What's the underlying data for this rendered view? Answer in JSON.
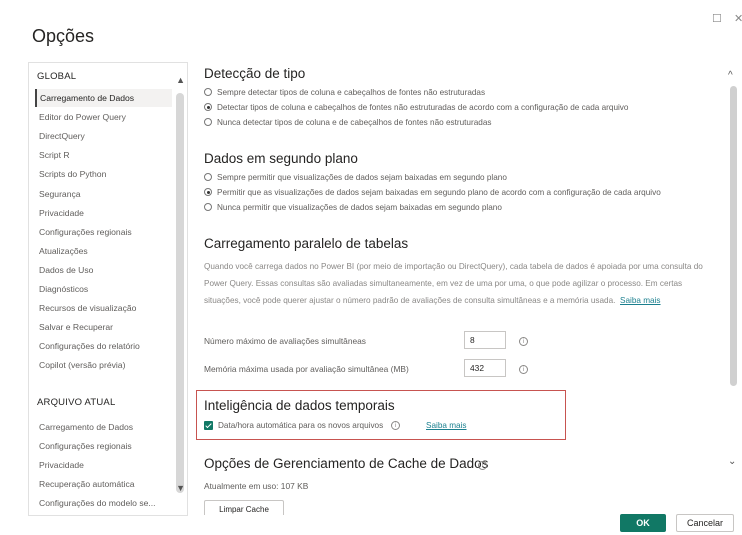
{
  "window": {
    "title": "Opções",
    "maximize_glyph": "☐",
    "close_glyph": "✕"
  },
  "nav": {
    "global_heading": "GLOBAL",
    "global_items": [
      "Carregamento de Dados",
      "Editor do Power Query",
      "DirectQuery",
      "Script R",
      "Scripts do Python",
      "Segurança",
      "Privacidade",
      "Configurações regionais",
      "Atualizações",
      "Dados de Uso",
      "Diagnósticos",
      "Recursos de visualização",
      "Salvar e Recuperar",
      "Configurações do relatório",
      "Copilot (versão prévia)"
    ],
    "current_heading": "ARQUIVO ATUAL",
    "current_items": [
      "Carregamento de Dados",
      "Configurações regionais",
      "Privacidade",
      "Recuperação automática",
      "Configurações do modelo se..."
    ],
    "active_item": "Carregamento de Dados"
  },
  "type_detection": {
    "title": "Detecção de tipo",
    "options": [
      {
        "label": "Sempre detectar tipos de coluna e cabeçalhos de fontes não estruturadas",
        "selected": false
      },
      {
        "label": "Detectar tipos de coluna e cabeçalhos de fontes não estruturadas de acordo com a configuração de cada arquivo",
        "selected": true
      },
      {
        "label": "Nunca detectar tipos de coluna e de cabeçalhos de fontes não estruturadas",
        "selected": false
      }
    ]
  },
  "background_data": {
    "title": "Dados em segundo plano",
    "options": [
      {
        "label": "Sempre permitir que visualizações de dados sejam baixadas em segundo plano",
        "selected": false
      },
      {
        "label": "Permitir que as visualizações de dados sejam baixadas em segundo plano de acordo com a configuração de cada arquivo",
        "selected": true
      },
      {
        "label": "Nunca permitir que visualizações de dados sejam baixadas em segundo plano",
        "selected": false
      }
    ]
  },
  "parallel_loading": {
    "title": "Carregamento paralelo de tabelas",
    "description": "Quando você carrega dados no Power BI (por meio de importação ou DirectQuery), cada tabela de dados é apoiada por uma consulta do Power Query. Essas consultas são avaliadas simultaneamente, em vez de uma por uma, o que pode agilizar o processo. Em certas situações, você pode querer ajustar o número padrão de avaliações de consulta simultâneas e a memória usada.",
    "learn_more": "Saiba mais",
    "max_evaluations_label": "Número máximo de avaliações simultâneas",
    "max_evaluations_value": "8",
    "max_memory_label": "Memória máxima usada por avaliação simultânea (MB)",
    "max_memory_value": "432",
    "info_glyph": "i"
  },
  "time_intelligence": {
    "title": "Inteligência de dados temporais",
    "checkbox_label": "Data/hora automática para os novos arquivos",
    "checked": true,
    "learn_more": "Saiba mais"
  },
  "cache": {
    "title": "Opções de Gerenciamento de Cache de Dados",
    "usage": "Atualmente em uso: 107 KB",
    "clear_button": "Limpar Cache"
  },
  "footer": {
    "ok": "OK",
    "cancel": "Cancelar"
  },
  "colors": {
    "accent": "#117865",
    "link": "#1a7f8e",
    "highlight_border": "#c75450"
  }
}
